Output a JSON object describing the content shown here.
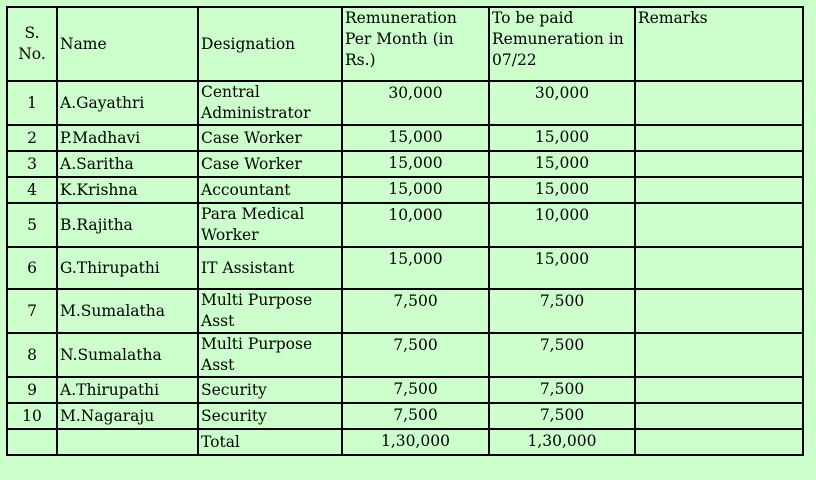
{
  "headers": {
    "sno": "S. No.",
    "name": "Name",
    "designation": "Designation",
    "remuneration": "Remuneration Per Month (in Rs.)",
    "to_be_paid": "To be paid Remuneration in 07/22",
    "remarks": "Remarks"
  },
  "rows": [
    {
      "sno": "1",
      "name": "A.Gayathri",
      "designation": "Central Administrator",
      "remuneration": "30,000",
      "to_be_paid": "30,000",
      "remarks": ""
    },
    {
      "sno": "2",
      "name": "P.Madhavi",
      "designation": "Case Worker",
      "remuneration": "15,000",
      "to_be_paid": "15,000",
      "remarks": ""
    },
    {
      "sno": "3",
      "name": "A.Saritha",
      "designation": "Case Worker",
      "remuneration": "15,000",
      "to_be_paid": "15,000",
      "remarks": ""
    },
    {
      "sno": "4",
      "name": "K.Krishna",
      "designation": "Accountant",
      "remuneration": "15,000",
      "to_be_paid": "15,000",
      "remarks": ""
    },
    {
      "sno": "5",
      "name": "B.Rajitha",
      "designation": "Para Medical Worker",
      "remuneration": "10,000",
      "to_be_paid": "10,000",
      "remarks": ""
    },
    {
      "sno": "6",
      "name": "G.Thirupathi",
      "designation": "IT Assistant",
      "remuneration": "15,000",
      "to_be_paid": "15,000",
      "remarks": ""
    },
    {
      "sno": "7",
      "name": "M.Sumalatha",
      "designation": "Multi Purpose Asst",
      "remuneration": "7,500",
      "to_be_paid": "7,500",
      "remarks": ""
    },
    {
      "sno": "8",
      "name": "N.Sumalatha",
      "designation": "Multi Purpose Asst",
      "remuneration": "7,500",
      "to_be_paid": "7,500",
      "remarks": ""
    },
    {
      "sno": "9",
      "name": "A.Thirupathi",
      "designation": "Security",
      "remuneration": "7,500",
      "to_be_paid": "7,500",
      "remarks": ""
    },
    {
      "sno": "10",
      "name": "M.Nagaraju",
      "designation": "Security",
      "remuneration": "7,500",
      "to_be_paid": "7,500",
      "remarks": ""
    }
  ],
  "total": {
    "label": "Total",
    "remuneration": "1,30,000",
    "to_be_paid": "1,30,000"
  }
}
